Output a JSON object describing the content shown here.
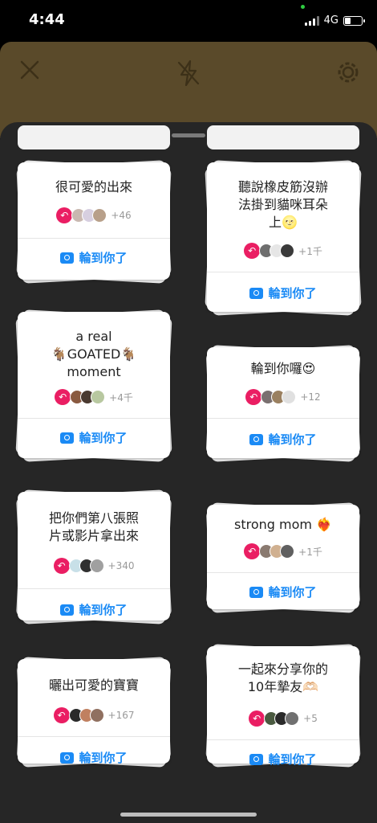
{
  "status": {
    "time": "4:44",
    "network": "4G"
  },
  "camera": {
    "close_icon": "close-icon",
    "flash_icon": "flash-off-icon",
    "settings_icon": "settings-icon"
  },
  "cta_label": "輪到你了",
  "cards": [
    {
      "prompt_lines": [
        "很可愛的出來"
      ],
      "count": "+46",
      "avatars": [
        "#c9b8b0",
        "#d7cfe0",
        "#b8a08a"
      ]
    },
    {
      "prompt_lines": [
        "聽說橡皮筋沒辦",
        "法掛到貓咪耳朵",
        "上🌝"
      ],
      "count": "+1千",
      "avatars": [
        "#6e6e6e",
        "#e6e6e6",
        "#3a3a3a"
      ]
    },
    {
      "prompt_lines": [
        "a real",
        "🐐GOATED🐐",
        "moment"
      ],
      "count": "+4千",
      "avatars": [
        "#8a5a40",
        "#4a3a30",
        "#b8c8a0"
      ]
    },
    {
      "prompt_lines": [
        "輪到你囉😍"
      ],
      "count": "+12",
      "avatars": [
        "#7a7070",
        "#9a8060",
        "#e0e0e0"
      ]
    },
    {
      "prompt_lines": [
        "把你們第八張照",
        "片或影片拿出來"
      ],
      "count": "+340",
      "avatars": [
        "#c8e0e8",
        "#303030",
        "#a0a0a0"
      ]
    },
    {
      "prompt_lines": [
        "strong mom ❤️‍🔥"
      ],
      "count": "+1千",
      "avatars": [
        "#8a7a70",
        "#d0b090",
        "#606060"
      ]
    },
    {
      "prompt_lines": [
        "曬出可愛的寶寶"
      ],
      "count": "+167",
      "avatars": [
        "#2a2a2a",
        "#c08060",
        "#907060"
      ]
    },
    {
      "prompt_lines": [
        "一起來分享你的",
        "10年摯友🫶🏻"
      ],
      "count": "+5",
      "avatars": [
        "#4a5a40",
        "#2a2a2a",
        "#707070"
      ]
    }
  ]
}
